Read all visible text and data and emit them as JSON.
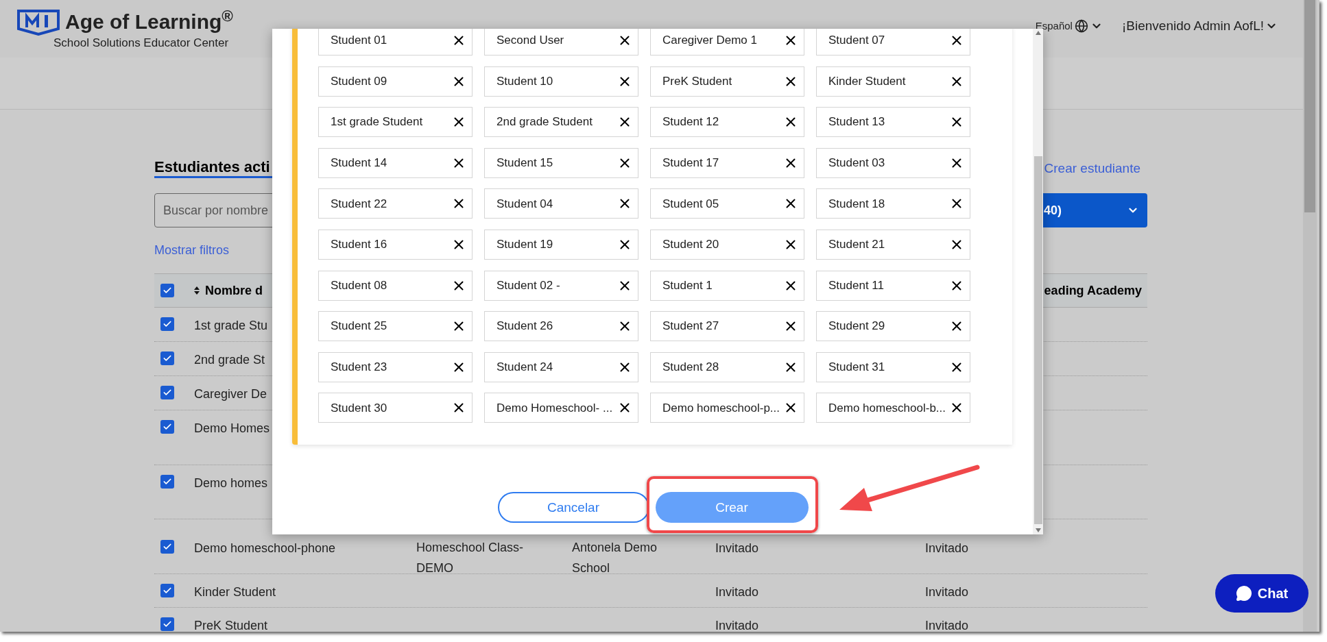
{
  "header": {
    "brand": "Age of Learning$^{®}$",
    "subtitle": "School Solutions Educator Center",
    "language": "Español",
    "welcome": "¡Bienvenido Admin AofL!"
  },
  "page": {
    "title": "Estudiantes acti",
    "create_link": "Crear estudiante",
    "search": {
      "placeholder": "Buscar por nombre"
    },
    "class_dropdown": "40)",
    "filters_link": "Mostrar filtros",
    "table": {
      "all_checked": true,
      "columns": [
        "Nombre d",
        "eading Academy"
      ],
      "rows": [
        {
          "checked": true,
          "name": "1st grade Stu"
        },
        {
          "checked": true,
          "name": "2nd grade St"
        },
        {
          "checked": true,
          "name": "Caregiver De"
        },
        {
          "checked": true,
          "name": "Demo Homes"
        },
        {
          "checked": true,
          "name": "Demo homes"
        },
        {
          "checked": true,
          "name": "Demo homeschool-phone",
          "column_2": "Homeschool Class-DEMO",
          "column_3": "Antonela Demo School",
          "column_4": "Invitado",
          "column_5": "Invitado"
        },
        {
          "checked": true,
          "name": "Kinder Student",
          "column_4": "Invitado",
          "column_5": "Invitado"
        },
        {
          "checked": true,
          "name": "PreK Student",
          "column_4": "Invitado",
          "column_5": "Invitado"
        }
      ]
    }
  },
  "modal": {
    "chips": [
      "Student 01",
      "Second User",
      "Caregiver Demo 1",
      "Student 07",
      "Student 09",
      "Student 10",
      "PreK Student",
      "Kinder Student",
      "1st grade Student",
      "2nd grade Student",
      "Student 12",
      "Student 13",
      "Student 14",
      "Student 15",
      "Student 17",
      "Student 03",
      "Student 22",
      "Student 04",
      "Student 05",
      "Student 18",
      "Student 16",
      "Student 19",
      "Student 20",
      "Student 21",
      "Student 08",
      "Student 02 -",
      "Student 1",
      "Student 11",
      "Student 25",
      "Student 26",
      "Student 27",
      "Student 29",
      "Student 23",
      "Student 24",
      "Student 28",
      "Student 31",
      "Student 30",
      "Demo Homeschool- ...",
      "Demo homeschool-p...",
      "Demo homeschool-b..."
    ],
    "cancel_button": "Cancelar",
    "create_button": "Crear"
  },
  "chat": {
    "label": "Chat"
  }
}
